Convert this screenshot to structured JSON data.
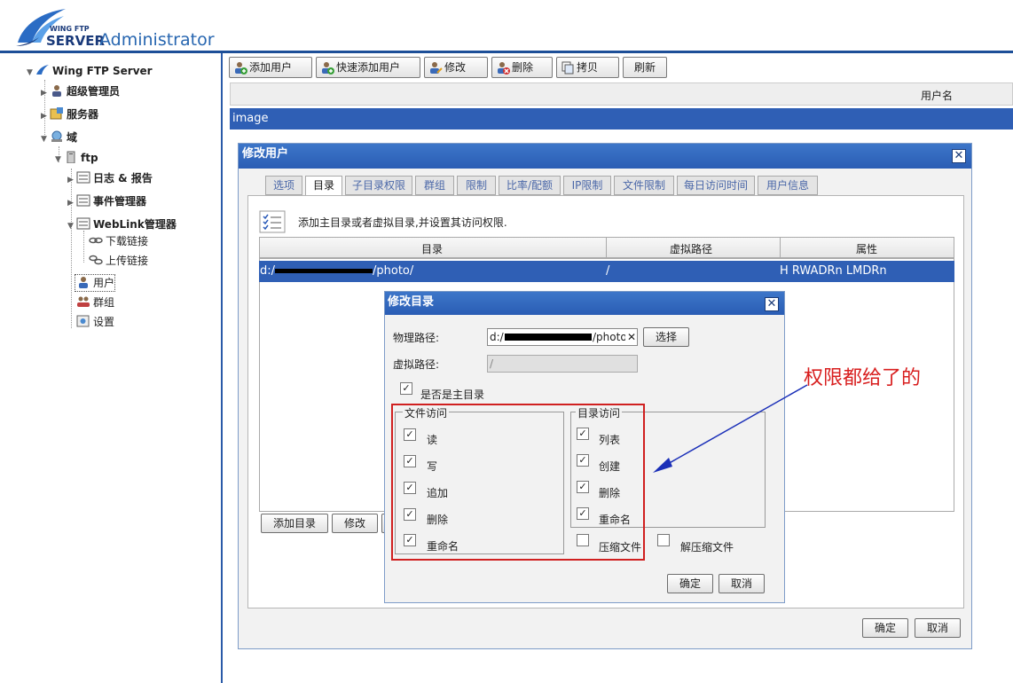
{
  "header": {
    "logo_small": "WING FTP",
    "logo_server": "SERVER",
    "title": "Administrator"
  },
  "sidebar": {
    "root": "Wing FTP Server",
    "admins": "超级管理员",
    "servers": "服务器",
    "domains": "域",
    "domain_ftp": "ftp",
    "logs": "日志 & 报告",
    "events": "事件管理器",
    "weblink": "WebLink管理器",
    "download_links": "下载链接",
    "upload_links": "上传链接",
    "users": "用户",
    "groups": "群组",
    "settings": "设置"
  },
  "toolbar": {
    "add_user": "添加用户",
    "quick_add_user": "快速添加用户",
    "modify": "修改",
    "delete": "删除",
    "copy": "拷贝",
    "refresh": "刷新"
  },
  "user_list": {
    "column_username": "用户名",
    "rows": [
      "image"
    ]
  },
  "modify_user_dialog": {
    "title": "修改用户",
    "tabs": [
      "选项",
      "目录",
      "子目录权限",
      "群组",
      "限制",
      "比率/配额",
      "IP限制",
      "文件限制",
      "每日访问时间",
      "用户信息"
    ],
    "active_tab": "目录",
    "hint": "添加主目录或者虚拟目录,并设置其访问权限.",
    "table_headers": [
      "目录",
      "虚拟路径",
      "属性"
    ],
    "rows": [
      {
        "dir_prefix": "d:/",
        "dir_suffix": "/photo/",
        "virtual": "/",
        "attr": "H RWADRn LMDRn"
      }
    ],
    "add_dir": "添加目录",
    "modify": "修改",
    "ok": "确定",
    "cancel": "取消"
  },
  "modify_dir_dialog": {
    "title": "修改目录",
    "physical_path_label": "物理路径:",
    "physical_path_prefix": "d:/",
    "physical_path_suffix": "/photo",
    "clear_icon": "✕",
    "choose": "选择",
    "virtual_path_label": "虚拟路径:",
    "virtual_path_value": "/",
    "is_home": "是否是主目录",
    "is_home_checked": true,
    "file_access_title": "文件访问",
    "file_access": [
      {
        "label": "读",
        "checked": true
      },
      {
        "label": "写",
        "checked": true
      },
      {
        "label": "追加",
        "checked": true
      },
      {
        "label": "删除",
        "checked": true
      },
      {
        "label": "重命名",
        "checked": true
      }
    ],
    "dir_access_title": "目录访问",
    "dir_access": [
      {
        "label": "列表",
        "checked": true
      },
      {
        "label": "创建",
        "checked": true
      },
      {
        "label": "删除",
        "checked": true
      },
      {
        "label": "重命名",
        "checked": true
      }
    ],
    "compress": {
      "label": "压缩文件",
      "checked": false
    },
    "decompress": {
      "label": "解压缩文件",
      "checked": false
    },
    "ok": "确定",
    "cancel": "取消"
  },
  "annotation": {
    "text": "权限都给了的",
    "color": "#d81e1e",
    "arrow_color": "#1a2fb8"
  },
  "colors": {
    "accent": "#2f5fb5",
    "header_line": "#1d4f98"
  }
}
